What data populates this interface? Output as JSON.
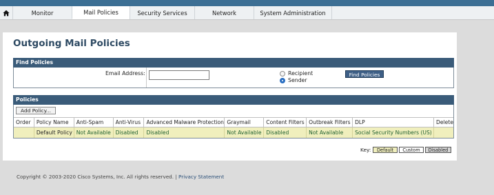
{
  "nav": {
    "tabs": [
      {
        "label": "Monitor"
      },
      {
        "label": "Mail Policies"
      },
      {
        "label": "Security Services"
      },
      {
        "label": "Network"
      },
      {
        "label": "System Administration"
      }
    ],
    "active_tab": "Mail Policies"
  },
  "page": {
    "title": "Outgoing Mail Policies"
  },
  "find": {
    "header": "Find Policies",
    "email_label": "Email Address:",
    "email_value": "",
    "options": [
      {
        "label": "Recipient",
        "checked": false
      },
      {
        "label": "Sender",
        "checked": true
      }
    ],
    "button": "Find Policies"
  },
  "policies": {
    "header": "Policies",
    "add_button": "Add Policy...",
    "columns": [
      "Order",
      "Policy Name",
      "Anti-Spam",
      "Anti-Virus",
      "Advanced Malware Protection",
      "Graymail",
      "Content Filters",
      "Outbreak Filters",
      "DLP",
      "Delete"
    ],
    "rows": [
      {
        "order": "",
        "name": "Default Policy",
        "anti_spam": "Not Available",
        "anti_virus": "Disabled",
        "amp": "Disabled",
        "graymail": "Not Available",
        "content_filters": "Disabled",
        "outbreak_filters": "Not Available",
        "dlp": "Social Security Numbers (US)",
        "delete": ""
      }
    ]
  },
  "key": {
    "label": "Key:",
    "items": [
      {
        "label": "Default",
        "color": "#f0efbd"
      },
      {
        "label": "Custom",
        "color": "#ffffff"
      },
      {
        "label": "Disabled",
        "color": "#d4d4d4"
      }
    ]
  },
  "footer": {
    "copyright": "Copyright © 2003-2020 Cisco Systems, Inc. All rights reserved.",
    "separator": "|",
    "privacy_link": "Privacy Statement"
  },
  "colors": {
    "header_bar": "#3a5b79",
    "title": "#2e4a63",
    "default_row": "#f0efbd",
    "status_text": "#1f5f2f"
  }
}
